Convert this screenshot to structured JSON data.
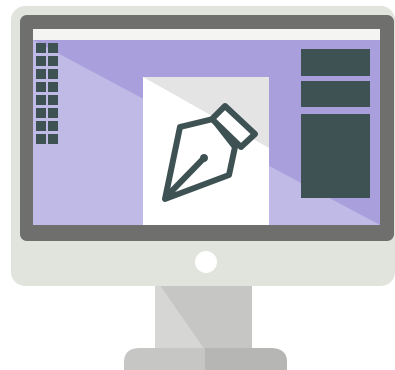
{
  "illustration": {
    "subject": "desktop-monitor-with-pen-tool",
    "colors": {
      "background": "#ffffff",
      "monitor_body": "#e1e3dd",
      "monitor_bezel": "#6f6f6e",
      "screen_top_strip": "#f4f4f2",
      "screen_purple_light": "#c0bae6",
      "screen_purple_mid": "#a89fdc",
      "screen_purple_dark": "#9b92d6",
      "panel_dark": "#3e5153",
      "canvas_white": "#ffffff",
      "canvas_shade": "#e4e4e4",
      "pen_stroke": "#3e5153",
      "power_button": "#ffffff",
      "stand_light": "#d6d6d4",
      "stand_mid": "#c6c6c4",
      "stand_dark": "#b6b6b4"
    },
    "icons": [
      "pen-tool-icon"
    ]
  }
}
